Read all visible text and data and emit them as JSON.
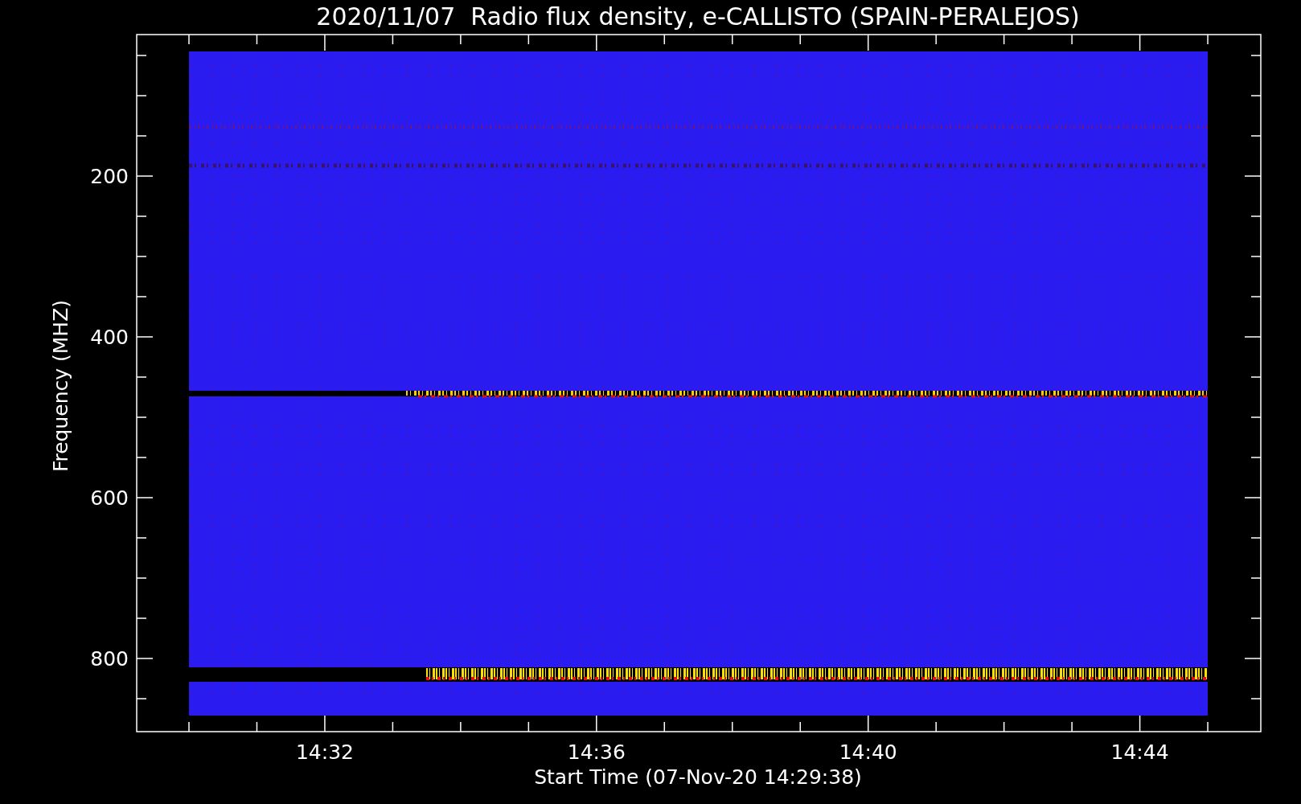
{
  "plot": {
    "title": "2020/11/07  Radio flux density, e-CALLISTO (SPAIN-PERALEJOS)",
    "ylabel": "Frequency (MHZ)",
    "xlabel": "Start Time (07-Nov-20 14:29:38)",
    "yticks": [
      "200",
      "400",
      "600",
      "800"
    ],
    "xticks": [
      "14:32",
      "14:36",
      "14:40",
      "14:44"
    ]
  }
}
